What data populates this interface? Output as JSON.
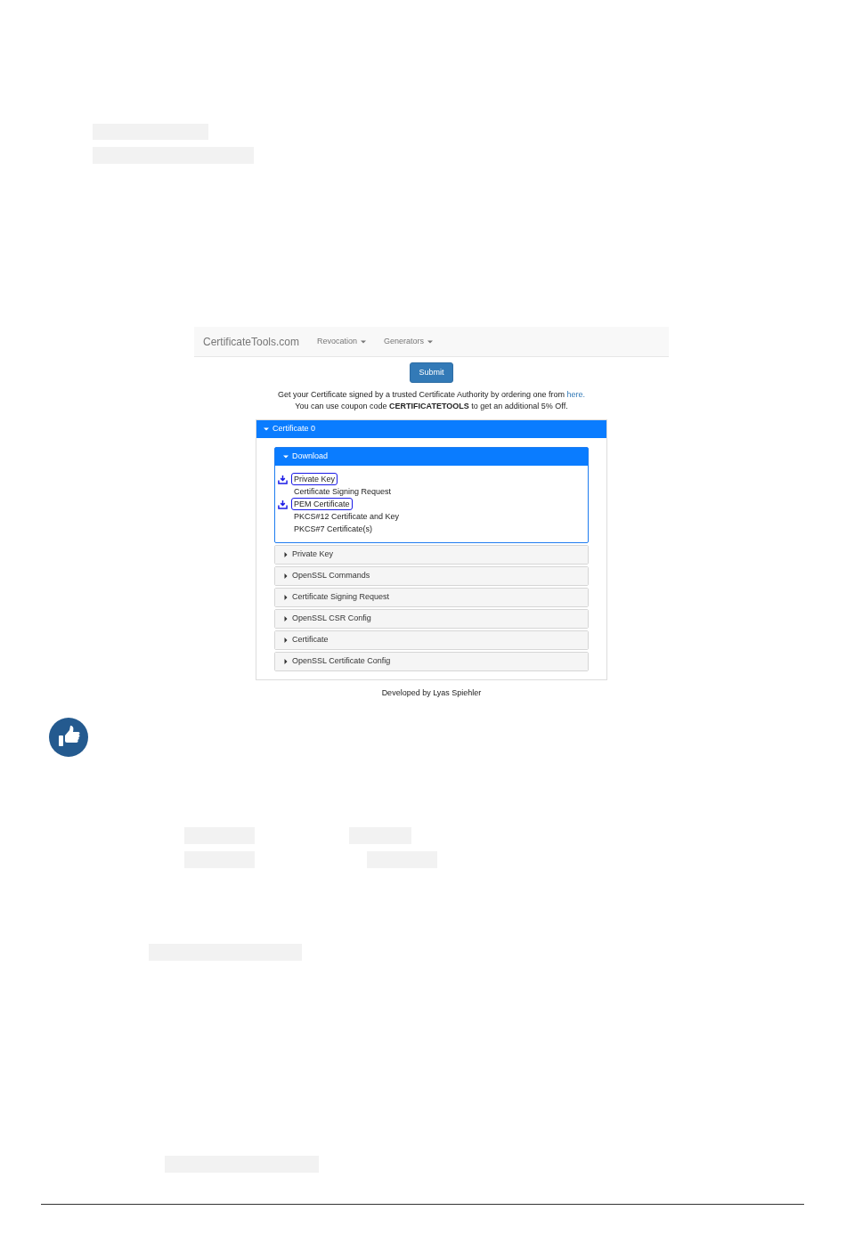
{
  "navbar": {
    "brand": "CertificateTools.com",
    "menus": [
      {
        "label": "Revocation"
      },
      {
        "label": "Generators"
      }
    ]
  },
  "submit": "Submit",
  "notice": {
    "line1": "Get your Certificate signed by a trusted Certificate Authority by ordering one from",
    "link": "here.",
    "line2": "You can use coupon code **CERTIFICATETOOLS** to get an additional 5% Off."
  },
  "certificate": {
    "title": "Certificate 0",
    "expanded": true,
    "sections": [
      {
        "title": "Download",
        "expanded": true,
        "active": true,
        "items": [
          {
            "label": "Private Key",
            "highlighted": true
          },
          {
            "label": "Certificate Signing Request",
            "highlighted": false
          },
          {
            "label": "PEM Certificate",
            "highlighted": true
          },
          {
            "label": "PKCS#12 Certificate and Key",
            "highlighted": false
          },
          {
            "label": "PKCS#7 Certificate(s)",
            "highlighted": false
          }
        ]
      },
      {
        "title": "Private Key",
        "expanded": false,
        "active": false
      },
      {
        "title": "OpenSSL Commands",
        "expanded": false,
        "active": false
      },
      {
        "title": "Certificate Signing Request",
        "expanded": false,
        "active": false
      },
      {
        "title": "OpenSSL CSR Config",
        "expanded": false,
        "active": false
      },
      {
        "title": "Certificate",
        "expanded": false,
        "active": false
      },
      {
        "title": "OpenSSL Certificate Config",
        "expanded": false,
        "active": false
      }
    ]
  },
  "footer": "Developed by Lyas Spiehler"
}
